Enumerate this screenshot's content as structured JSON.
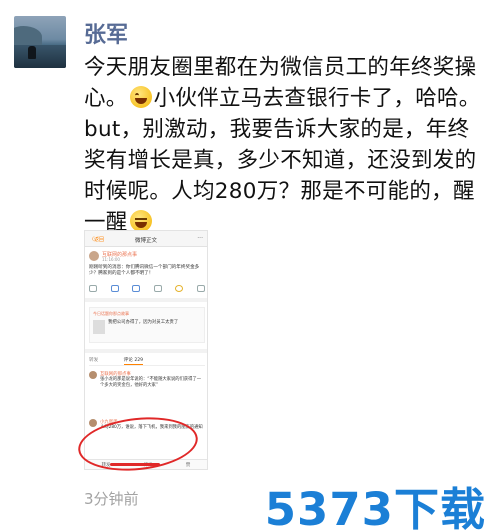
{
  "post": {
    "author": "张军",
    "text_part1": "今天朋友圈里都在为微信员工的年终奖操心。",
    "text_part2": "小伙伴立马去查银行卡了，哈哈。but，别激动，我要告诉大家的是，年终奖有增长是真，多少不知道，还没到发的时候呢。人均280万？那是不可能的，醒一醒",
    "time": "3分钟前"
  },
  "screenshot": {
    "back": "〈返回",
    "title": "微博正文",
    "more": "···",
    "name": "互联网的那点事",
    "time": "11:16:00",
    "body": "刚刚听到的消息：你们腾讯微信一个部门的年终奖金多少？腾家到的是个人都不明了！",
    "quote_source": "今日话题你那点故事",
    "quote_text": "我把公司办得了，因为对员工太贵了",
    "tab_reposts": "转发",
    "tab_comments": "评论 229",
    "comment1_name": "互联网的那点事",
    "comment1_text": "张小龙的那是说年说的：“不能随大家说的们获得了一个多大的奖金包，他好的大家”",
    "comment2_name": "小九蛋蛋",
    "comment2_text": "人均280万，谁说，落下飞机，我来到我的朋友的通知",
    "bottom_left": "转发",
    "bottom_mid": "评论",
    "bottom_right": "赞"
  },
  "watermark": "5373下载"
}
